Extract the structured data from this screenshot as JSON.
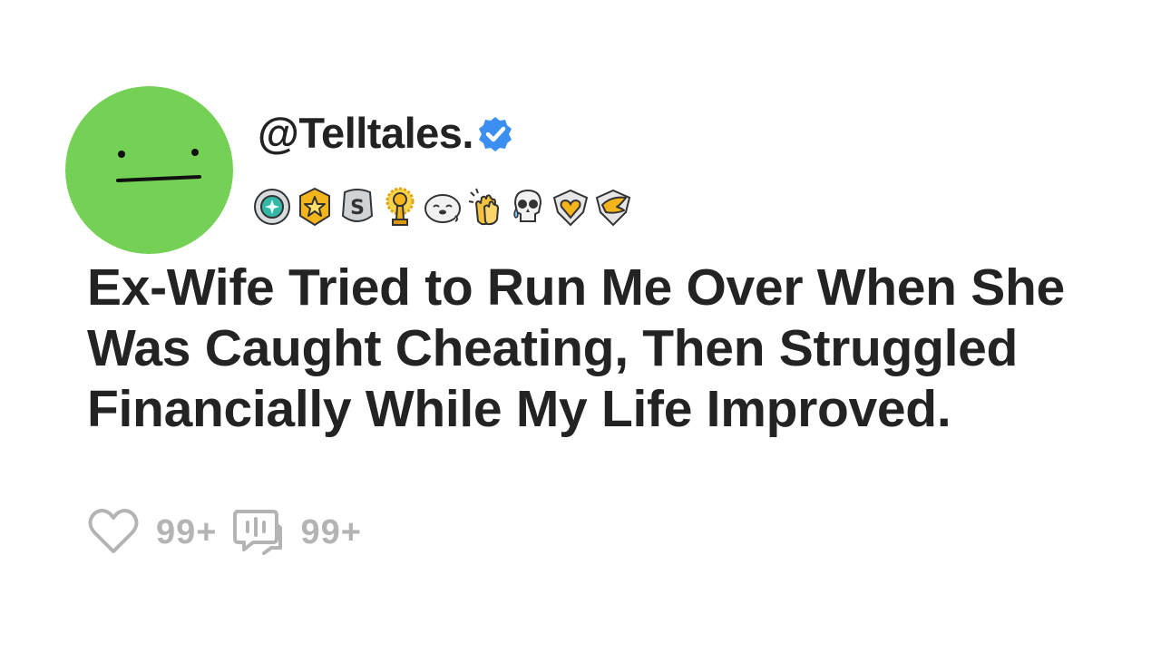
{
  "post": {
    "handle": "@Telltales.",
    "verified": true,
    "title": "Ex-Wife Tried to Run Me Over When She Was Caught Cheating, Then Struggled Financially While My Life Improved.",
    "avatar_color": "#74d155",
    "awards": [
      "gem-medal-icon",
      "gold-star-badge-icon",
      "silver-s-badge-icon",
      "gold-trophy-icon",
      "seal-face-icon",
      "clapping-hands-icon",
      "crying-skull-icon",
      "heart-shield-icon",
      "wing-shield-icon"
    ],
    "stats": {
      "likes": "99+",
      "comments": "99+"
    }
  }
}
